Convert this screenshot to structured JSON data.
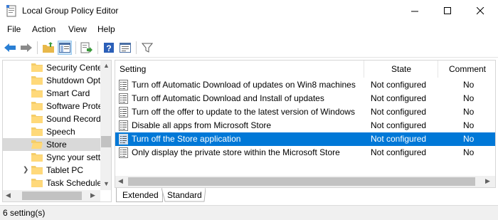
{
  "window": {
    "title": "Local Group Policy Editor"
  },
  "menu": [
    "File",
    "Action",
    "View",
    "Help"
  ],
  "toolbar": {
    "icons": [
      "back-arrow-icon",
      "forward-arrow-icon",
      "up-folder-icon",
      "show-hide-tree-icon",
      "export-list-icon",
      "help-icon",
      "properties-icon",
      "filter-icon"
    ]
  },
  "tree": {
    "items": [
      {
        "label": "Security Cente"
      },
      {
        "label": "Shutdown Opt"
      },
      {
        "label": "Smart Card"
      },
      {
        "label": "Software Prote"
      },
      {
        "label": "Sound Record"
      },
      {
        "label": "Speech"
      },
      {
        "label": "Store"
      },
      {
        "label": "Sync your sett"
      },
      {
        "label": "Tablet PC"
      },
      {
        "label": "Task Schedule"
      }
    ],
    "selected": "Store"
  },
  "list": {
    "columns": {
      "setting": "Setting",
      "state": "State",
      "comment": "Comment"
    },
    "rows": [
      {
        "setting": "Turn off Automatic Download of updates on Win8 machines",
        "state": "Not configured",
        "comment": "No"
      },
      {
        "setting": "Turn off Automatic Download and Install of updates",
        "state": "Not configured",
        "comment": "No"
      },
      {
        "setting": "Turn off the offer to update to the latest version of Windows",
        "state": "Not configured",
        "comment": "No"
      },
      {
        "setting": "Disable all apps from Microsoft Store",
        "state": "Not configured",
        "comment": "No"
      },
      {
        "setting": "Turn off the Store application",
        "state": "Not configured",
        "comment": "No"
      },
      {
        "setting": "Only display the private store within the Microsoft Store",
        "state": "Not configured",
        "comment": "No"
      }
    ],
    "selected_row": "Turn off the Store application"
  },
  "tabs": {
    "extended": "Extended",
    "standard": "Standard"
  },
  "status": {
    "text": "6 setting(s)"
  },
  "colors": {
    "selection": "#0078d7",
    "tree_selection": "#d9d9d9"
  }
}
